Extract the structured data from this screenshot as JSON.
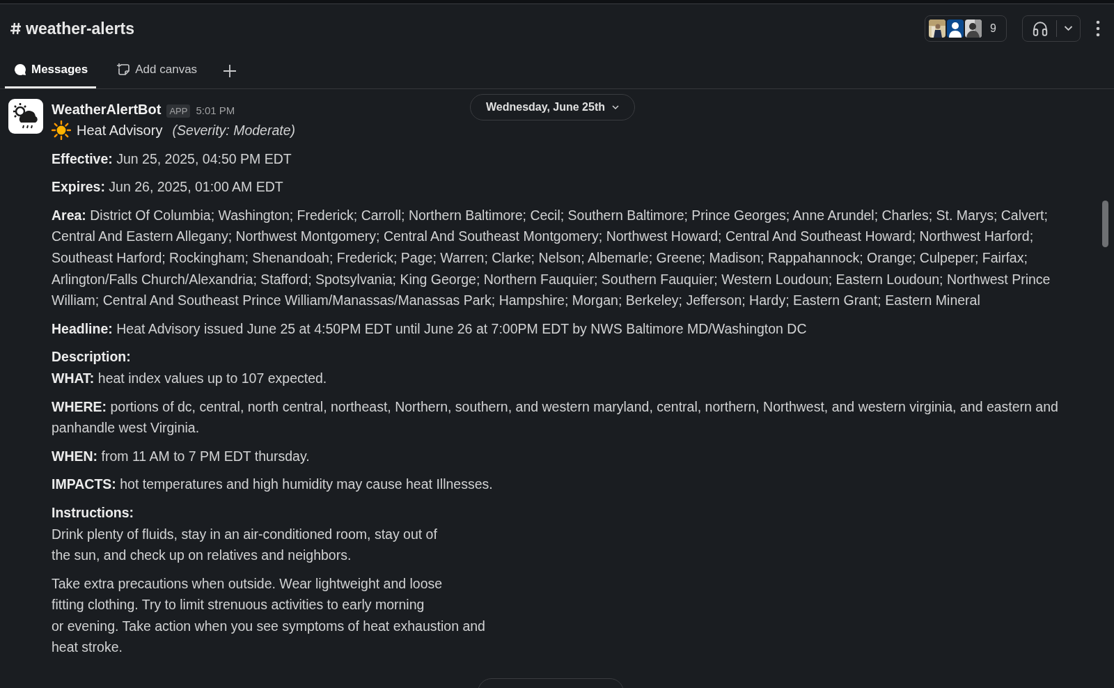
{
  "channel": {
    "name": "weather-alerts",
    "member_count": "9"
  },
  "tabs": [
    {
      "label": "Messages",
      "selected": true
    },
    {
      "label": "Add canvas",
      "selected": false
    }
  ],
  "date_dividers": [
    "Wednesday, June 25th"
  ],
  "message": {
    "sender": "WeatherAlertBot",
    "badge": "APP",
    "time": "5:01 PM",
    "title": "Heat Advisory",
    "severity": "(Severity: Moderate)",
    "blocks": [
      {
        "lines": [
          "**Effective:** Jun 25, 2025, 04:50 PM EDT"
        ]
      },
      {
        "lines": [
          "**Expires:** Jun 26, 2025, 01:00 AM EDT"
        ]
      },
      {
        "lines": [
          "**Area:** District Of Columbia; Washington; Frederick; Carroll; Northern Baltimore; Cecil; Southern Baltimore; Prince Georges; Anne Arundel; Charles; St. Marys; Calvert; Central And Eastern Allegany; Northwest Montgomery; Central And Southeast Montgomery; Northwest Howard; Central And Southeast Howard; Northwest Harford; Southeast Harford; Rockingham; Shenandoah; Frederick; Page; Warren; Clarke; Nelson; Albemarle; Greene; Madison; Rappahannock; Orange; Culpeper; Fairfax; Arlington/Falls Church/Alexandria; Stafford; Spotsylvania; King George; Northern Fauquier; Southern Fauquier; Western Loudoun; Eastern Loudoun; Northwest Prince William; Central And Southeast Prince William/Manassas/Manassas Park; Hampshire; Morgan; Berkeley; Jefferson; Hardy; Eastern Grant; Eastern Mineral"
        ]
      },
      {
        "lines": [
          "**Headline:** Heat Advisory issued June 25 at 4:50PM EDT until June 26 at 7:00PM EDT by NWS Baltimore MD/Washington DC"
        ]
      },
      {
        "lines": [
          "**Description:**",
          "**WHAT:** heat index values up to 107 expected."
        ]
      },
      {
        "lines": [
          "**WHERE:** portions of dc, central, north central, northeast, Northern, southern, and western maryland, central, northern, Northwest, and western virginia, and eastern and panhandle west Virginia."
        ]
      },
      {
        "lines": [
          "**WHEN:** from 11 AM to 7 PM EDT thursday."
        ]
      },
      {
        "lines": [
          "**IMPACTS:** hot temperatures and high humidity may cause heat Illnesses."
        ]
      },
      {
        "lines": [
          "**Instructions:**",
          "Drink plenty of fluids, stay in an air-conditioned room, stay out of",
          "the sun, and check up on relatives and neighbors."
        ]
      },
      {
        "lines": [
          "Take extra precautions when outside. Wear lightweight and loose",
          "fitting clothing. Try to limit strenuous activities to early morning",
          "or evening. Take action when you see symptoms of heat exhaustion and",
          "heat stroke."
        ]
      }
    ]
  }
}
